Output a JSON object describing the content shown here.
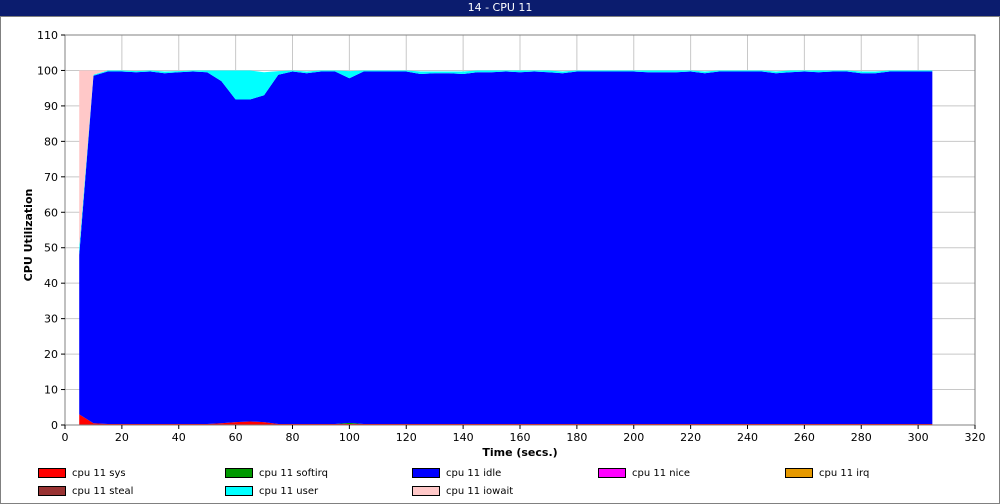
{
  "window": {
    "title": "14 - CPU 11"
  },
  "chart_data": {
    "type": "area",
    "stacked": true,
    "title": "14 - CPU 11",
    "xlabel": "Time (secs.)",
    "ylabel": "CPU Utilization",
    "xlim": [
      0,
      320
    ],
    "ylim": [
      0,
      110
    ],
    "xticks": [
      0,
      20,
      40,
      60,
      80,
      100,
      120,
      140,
      160,
      180,
      200,
      220,
      240,
      260,
      280,
      300,
      320
    ],
    "yticks": [
      0,
      10,
      20,
      30,
      40,
      50,
      60,
      70,
      80,
      90,
      100,
      110
    ],
    "grid": true,
    "legend_position": "bottom",
    "x": [
      5,
      10,
      15,
      20,
      25,
      30,
      35,
      40,
      45,
      50,
      55,
      60,
      65,
      70,
      75,
      80,
      85,
      90,
      95,
      100,
      105,
      110,
      115,
      120,
      125,
      130,
      135,
      140,
      145,
      150,
      155,
      160,
      165,
      170,
      175,
      180,
      185,
      190,
      195,
      200,
      205,
      210,
      215,
      220,
      225,
      230,
      235,
      240,
      245,
      250,
      255,
      260,
      265,
      270,
      275,
      280,
      285,
      290,
      295,
      300,
      305
    ],
    "series": [
      {
        "name": "cpu 11 sys",
        "color": "#ff0000",
        "values": [
          3,
          0.5,
          0.3,
          0.3,
          0.3,
          0.3,
          0.3,
          0.3,
          0.3,
          0.3,
          0.5,
          0.8,
          1,
          0.8,
          0.3,
          0.3,
          0.3,
          0.3,
          0.3,
          0.3,
          0.3,
          0.3,
          0.3,
          0.3,
          0.3,
          0.3,
          0.3,
          0.3,
          0.3,
          0.3,
          0.3,
          0.3,
          0.3,
          0.3,
          0.3,
          0.3,
          0.3,
          0.3,
          0.3,
          0.3,
          0.3,
          0.3,
          0.3,
          0.3,
          0.3,
          0.3,
          0.3,
          0.3,
          0.3,
          0.3,
          0.3,
          0.3,
          0.3,
          0.3,
          0.3,
          0.3,
          0.3,
          0.3,
          0.3,
          0.3,
          0.3
        ]
      },
      {
        "name": "cpu 11 softirq",
        "color": "#009900",
        "values": [
          0,
          0,
          0,
          0,
          0,
          0,
          0,
          0,
          0,
          0,
          0,
          0,
          0,
          0,
          0,
          0,
          0,
          0,
          0,
          0.3,
          0,
          0,
          0,
          0,
          0,
          0,
          0,
          0,
          0,
          0,
          0,
          0,
          0,
          0,
          0,
          0,
          0,
          0,
          0,
          0,
          0,
          0,
          0,
          0,
          0,
          0,
          0,
          0,
          0,
          0,
          0,
          0,
          0,
          0,
          0,
          0,
          0,
          0,
          0,
          0,
          0
        ]
      },
      {
        "name": "cpu 11 idle",
        "color": "#0000ff",
        "values": [
          45,
          98,
          99.4,
          99.4,
          99.2,
          99.4,
          98.9,
          99.2,
          99.4,
          99.2,
          96.5,
          91,
          90.8,
          92.2,
          98.5,
          99.4,
          98.9,
          99.4,
          99.4,
          97.2,
          99.4,
          99.4,
          99.4,
          99.4,
          98.7,
          98.9,
          98.9,
          98.7,
          99.2,
          99.2,
          99.4,
          99.2,
          99.4,
          99.2,
          98.9,
          99.4,
          99.4,
          99.4,
          99.4,
          99.4,
          99.2,
          99.2,
          99.2,
          99.4,
          98.9,
          99.4,
          99.4,
          99.4,
          99.4,
          98.9,
          99.2,
          99.4,
          99.2,
          99.4,
          99.4,
          98.9,
          98.9,
          99.4,
          99.4,
          99.4,
          99.4
        ]
      },
      {
        "name": "cpu 11 nice",
        "color": "#ff00ff",
        "values": []
      },
      {
        "name": "cpu 11 irq",
        "color": "#e69900",
        "values": []
      },
      {
        "name": "cpu 11 steal",
        "color": "#993333",
        "values": []
      },
      {
        "name": "cpu 11 user",
        "color": "#00ffff",
        "values": [
          2,
          0.3,
          0.3,
          0.3,
          0.3,
          0.3,
          0.5,
          0.3,
          0.3,
          0.5,
          3,
          8.2,
          8.2,
          6.5,
          1,
          0.3,
          0.5,
          0.3,
          0.3,
          2,
          0.3,
          0.3,
          0.3,
          0.3,
          0.7,
          0.5,
          0.5,
          0.7,
          0.5,
          0.5,
          0.3,
          0.5,
          0.3,
          0.5,
          0.5,
          0.3,
          0.3,
          0.3,
          0.3,
          0.3,
          0.5,
          0.5,
          0.5,
          0.3,
          0.5,
          0.3,
          0.3,
          0.3,
          0.3,
          0.5,
          0.5,
          0.3,
          0.5,
          0.3,
          0.3,
          0.5,
          0.5,
          0.3,
          0.3,
          0.3,
          0.3
        ]
      },
      {
        "name": "cpu 11 iowait",
        "color": "#ffc8c8",
        "values": [
          50,
          1.2,
          0,
          0,
          0,
          0,
          0,
          0,
          0,
          0,
          0,
          0,
          0,
          0,
          0,
          0,
          0,
          0,
          0,
          0,
          0,
          0,
          0,
          0,
          0,
          0,
          0,
          0,
          0,
          0,
          0,
          0,
          0,
          0,
          0,
          0,
          0,
          0,
          0,
          0,
          0,
          0,
          0,
          0,
          0,
          0,
          0,
          0,
          0,
          0,
          0,
          0,
          0,
          0,
          0,
          0,
          0,
          0,
          0,
          0,
          0
        ]
      }
    ]
  }
}
